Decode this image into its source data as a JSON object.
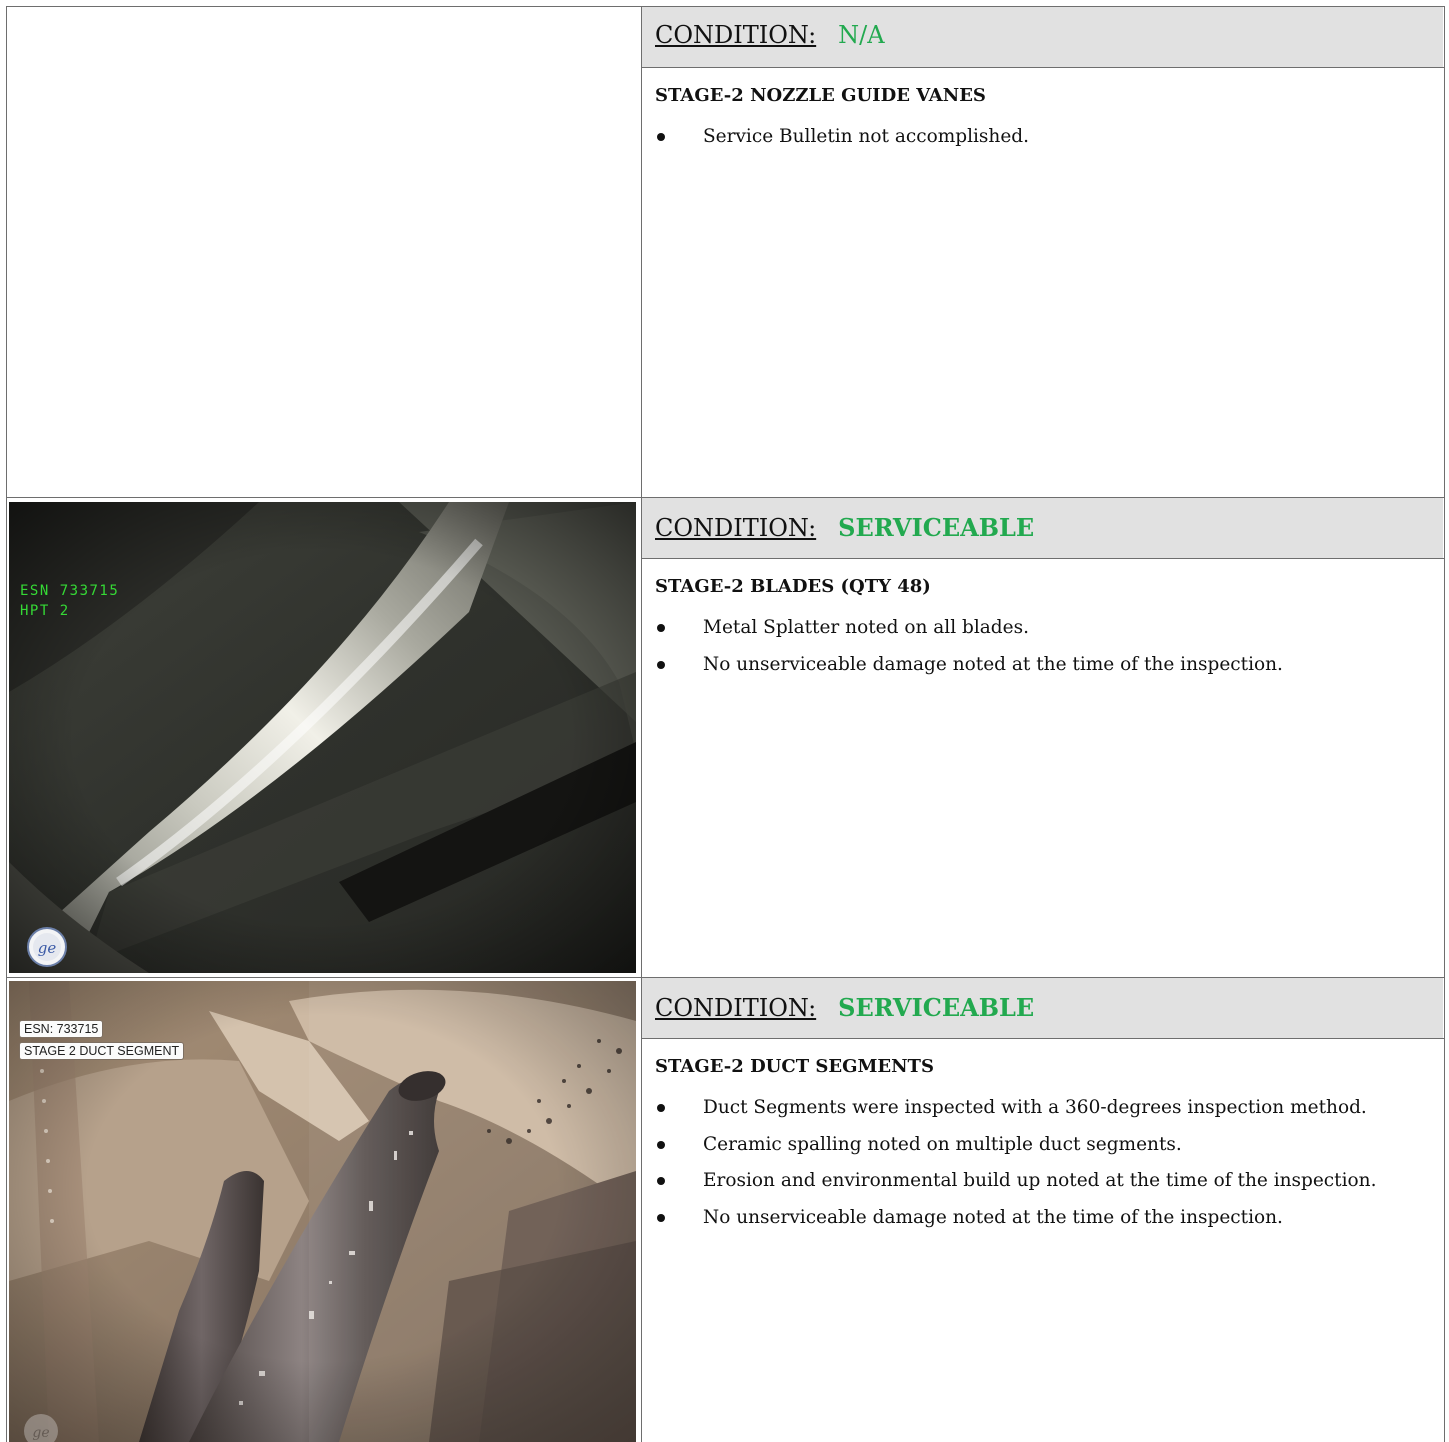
{
  "rows": [
    {
      "condition_label": "CONDITION:",
      "condition_value": "N/A",
      "title": "STAGE-2 NOZZLE GUIDE VANES",
      "bullets": [
        "Service Bulletin not accomplished."
      ]
    },
    {
      "condition_label": "CONDITION:",
      "condition_value": "SERVICEABLE",
      "title": "STAGE-2 BLADES  (QTY 48)",
      "bullets": [
        "Metal Splatter noted on all blades.",
        "No unserviceable damage noted at the time of the inspection."
      ],
      "photo": {
        "overlay_line1": "ESN 733715",
        "overlay_line2": "HPT 2",
        "logo": "ge-logo-icon"
      }
    },
    {
      "condition_label": "CONDITION:",
      "condition_value": "SERVICEABLE",
      "title": "STAGE-2 DUCT SEGMENTS",
      "bullets": [
        "Duct Segments were inspected with a 360-degrees inspection method.",
        "Ceramic spalling noted on multiple duct segments.",
        "Erosion and environmental build up noted at the time of the inspection.",
        "No unserviceable damage noted at the time of the inspection."
      ],
      "photo": {
        "tag_line1": "ESN: 733715",
        "tag_line2": "STAGE 2 DUCT SEGMENT",
        "logo": "ge-logo-icon"
      }
    }
  ],
  "colors": {
    "serviceable": "#22a94f",
    "header_bg": "#e1e1e1"
  }
}
